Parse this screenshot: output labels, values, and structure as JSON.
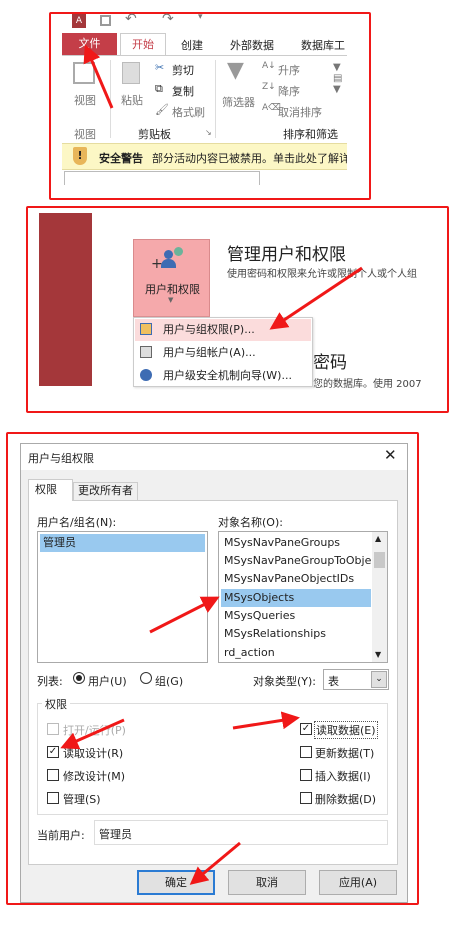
{
  "panel1": {
    "app_icon": "access-icon",
    "quick_access": [
      "save-icon",
      "undo-icon",
      "redo-icon",
      "customize-icon"
    ],
    "tabs": [
      "文件",
      "开始",
      "创建",
      "外部数据",
      "数据库工"
    ],
    "active_tab": "开始",
    "file_tab_color": "#c43e48",
    "groups": {
      "view": {
        "button": "视图",
        "label": "视图"
      },
      "clipboard": {
        "paste": "粘贴",
        "cut": "剪切",
        "copy": "复制",
        "format_painter": "格式刷",
        "label": "剪贴板"
      },
      "sort_filter": {
        "filter": "筛选器",
        "ascending": "升序",
        "descending": "降序",
        "clear_sort": "取消排序",
        "label": "排序和筛选"
      }
    },
    "security_bar": {
      "title": "安全警告",
      "message": "部分活动内容已被禁用。单击此处了解详",
      "color": "#fcf7c5"
    }
  },
  "panel2": {
    "sidebar_color": "#a4373a",
    "button_label": "用户和权限",
    "heading": "管理用户和权限",
    "description": "使用密码和权限来允许或限制个人或个人组",
    "menu": [
      "用户与组权限(P)...",
      "用户与组帐户(A)...",
      "用户级安全机制向导(W)..."
    ],
    "partial_heading": "密码",
    "partial_text": "您的数据库。使用 2007"
  },
  "dialog": {
    "title": "用户与组权限",
    "tabs": [
      "权限",
      "更改所有者"
    ],
    "user_list_label": "用户名/组名(N):",
    "users": [
      "管理员"
    ],
    "selected_user": "管理员",
    "object_list_label": "对象名称(O):",
    "objects": [
      "MSysNavPaneGroups",
      "MSysNavPaneGroupToObje",
      "MSysNavPaneObjectIDs",
      "MSysObjects",
      "MSysQueries",
      "MSysRelationships",
      "rd_action"
    ],
    "selected_object": "MSysObjects",
    "list_label": "列表:",
    "list_options": [
      "用户(U)",
      "组(G)"
    ],
    "list_selected": "用户(U)",
    "object_type_label": "对象类型(Y):",
    "object_type_value": "表",
    "permissions_label": "权限",
    "permissions_left": [
      {
        "label": "打开/运行(P)",
        "checked": false,
        "disabled": true
      },
      {
        "label": "读取设计(R)",
        "checked": true,
        "disabled": false
      },
      {
        "label": "修改设计(M)",
        "checked": false,
        "disabled": false
      },
      {
        "label": "管理(S)",
        "checked": false,
        "disabled": false
      }
    ],
    "permissions_right": [
      {
        "label": "读取数据(E)",
        "checked": true,
        "disabled": false
      },
      {
        "label": "更新数据(T)",
        "checked": false,
        "disabled": false
      },
      {
        "label": "插入数据(I)",
        "checked": false,
        "disabled": false
      },
      {
        "label": "删除数据(D)",
        "checked": false,
        "disabled": false
      }
    ],
    "current_user_label": "当前用户:",
    "current_user": "管理员",
    "buttons": {
      "ok": "确定",
      "cancel": "取消",
      "apply": "应用(A)"
    }
  },
  "annotation_color": "#f01818"
}
